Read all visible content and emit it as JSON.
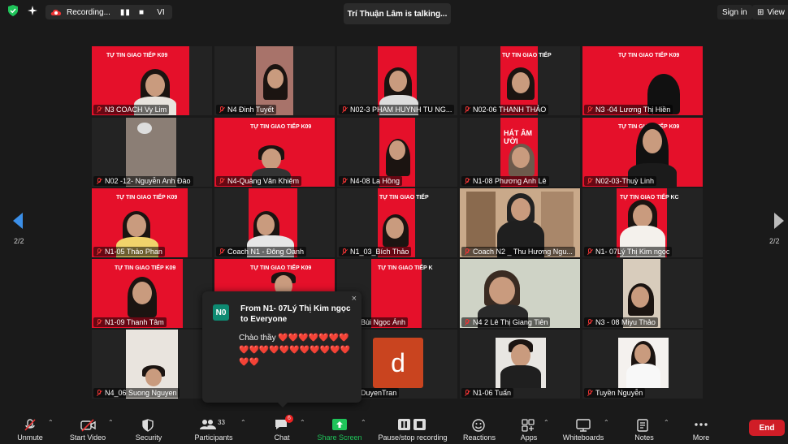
{
  "topbar": {
    "recording_label": "Recording...",
    "language_badge": "VI",
    "talking_indicator": "Trí Thuận Lâm is talking...",
    "sign_in": "Sign in",
    "view": "View"
  },
  "pagination": {
    "left": "2/2",
    "right": "2/2"
  },
  "slide_title": "TỰ TIN GIAO TIẾP K09",
  "tiles": [
    {
      "name": "N3 COACH Vy Lim"
    },
    {
      "name": "N4 Đinh Tuyết"
    },
    {
      "name": "N02-3 PHAM HUYNH TU NG..."
    },
    {
      "name": "N02-06 THANH THẢO"
    },
    {
      "name": "N3 -04 Lương Thị Hiền"
    },
    {
      "name": "N02 -12- Nguyễn Anh Đào"
    },
    {
      "name": "N4-Quảng Văn Khiêm"
    },
    {
      "name": "N4-08 La Hồng"
    },
    {
      "name": "N1-08 Phương Anh Lê"
    },
    {
      "name": "N02-03-Thuỳ Linh"
    },
    {
      "name": "N1-05 Thảo Phan"
    },
    {
      "name": "Coach N1 - Đông Oanh"
    },
    {
      "name": "N1_03_Bích Thảo"
    },
    {
      "name": "Coach N2 _ Thu Hương Ngu..."
    },
    {
      "name": "N1- 07Lý Thị Kim ngọc"
    },
    {
      "name": "N1-09 Thanh Tâm"
    },
    {
      "name": ""
    },
    {
      "name": "-01Bùi Ngọc Ánh"
    },
    {
      "name": "N4 2 Lê Thị Giang Tiên"
    },
    {
      "name": "N3 - 08 Miyu Thảo"
    },
    {
      "name": "N4_06 Suong Nguyen"
    },
    {
      "name": ""
    },
    {
      "name": "-03DuyenTran",
      "avatar_letter": "d"
    },
    {
      "name": "N1-06 Tuấn"
    },
    {
      "name": "Tuyền Nguyễn"
    }
  ],
  "chat_popup": {
    "avatar": "N0",
    "header": "From N1- 07Lý Thị Kim ngọc to Everyone",
    "message": "Chào thầy ❤️❤️❤️❤️❤️❤️❤️❤️❤️❤️❤️❤️❤️❤️❤️❤️❤️❤️❤️❤️",
    "close": "×"
  },
  "toolbar": {
    "unmute": "Unmute",
    "start_video": "Start Video",
    "security": "Security",
    "participants": "Participants",
    "participants_count": "33",
    "chat": "Chat",
    "chat_badge": "6",
    "share_screen": "Share Screen",
    "pause_recording": "Pause/stop recording",
    "reactions": "Reactions",
    "apps": "Apps",
    "whiteboards": "Whiteboards",
    "notes": "Notes",
    "more": "More",
    "end": "End"
  },
  "colors": {
    "accent_green": "#1fc45a",
    "end_red": "#d01d27",
    "slide_red": "#e5102a",
    "chat_avatar": "#0e8a72"
  }
}
